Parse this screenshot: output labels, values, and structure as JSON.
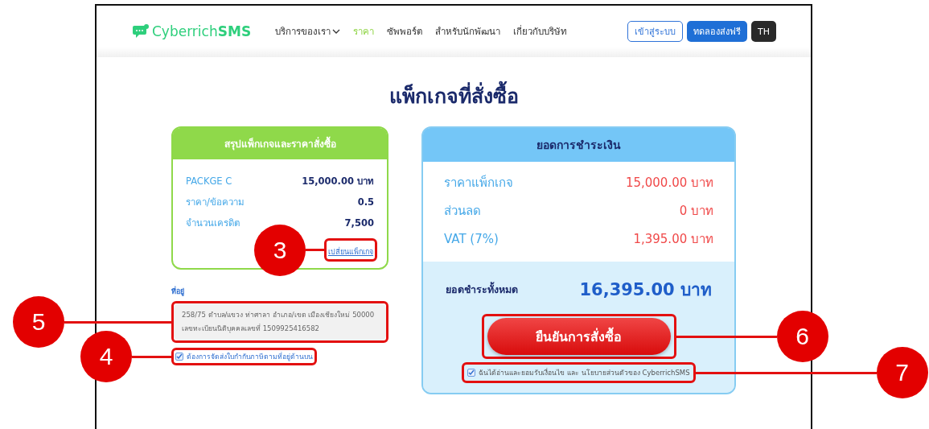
{
  "navbar": {
    "logo": {
      "text": "Cyberrich",
      "bold": "SMS"
    },
    "menu": [
      {
        "label": "บริการของเรา",
        "dropdown": true,
        "selected": false
      },
      {
        "label": "ราคา",
        "dropdown": false,
        "selected": true
      },
      {
        "label": "ซัพพอร์ต",
        "dropdown": false,
        "selected": false
      },
      {
        "label": "สำหรับนักพัฒนา",
        "dropdown": false,
        "selected": false
      },
      {
        "label": "เกี่ยวกับบริษัท",
        "dropdown": false,
        "selected": false
      }
    ],
    "login_button": "เข้าสู่ระบบ",
    "trial_button": "ทดลองส่งฟรี",
    "language": "TH"
  },
  "title": "แพ็กเกจที่สั่งซื้อ",
  "package_summary": {
    "header": "สรุปแพ็กเกจและราคาสั่งซื้อ",
    "rows": [
      {
        "label": "PACKGE C",
        "value": "15,000.00 บาท"
      },
      {
        "label": "ราคา/ข้อความ",
        "value": "0.5"
      },
      {
        "label": "จำนวนเครดิต",
        "value": "7,500"
      }
    ],
    "change_link": {
      "label": "เปลี่ยนแพ็กเกจ",
      "callout": "3"
    }
  },
  "address": {
    "label": "ที่อยู่",
    "lines": [
      "258/75 ตำบล/แขวง ท่าศาลา อำเภอ/เขต เมืองเชียงใหม่ 50000",
      "เลขทะเบียนนิติบุคคลเลขที่ 1509925416582"
    ],
    "callout": "5"
  },
  "ship_checkbox": {
    "label": "ต้องการจัดส่งใบกำกับภาษีตามที่อยู่ด้านบน",
    "checked": true,
    "callout": "4"
  },
  "payment": {
    "header": "ยอดการชำระเงิน",
    "rows": [
      {
        "label": "ราคาแพ็กเกจ",
        "value": "15,000.00 บาท"
      },
      {
        "label": "ส่วนลด",
        "value": "0 บาท"
      },
      {
        "label": "VAT (7%)",
        "value": "1,395.00 บาท"
      }
    ],
    "total_label": "ยอดชำระทั้งหมด",
    "total_value": "16,395.00 บาท",
    "confirm_button": {
      "label": "ยืนยันการสั่งซื้อ",
      "callout": "6"
    },
    "agree_checkbox": {
      "label": "ฉันได้อ่านและยอมรับเงื่อนไข และ นโยบายส่วนตัวของ CyberrichSMS",
      "checked": true,
      "callout": "7"
    }
  }
}
